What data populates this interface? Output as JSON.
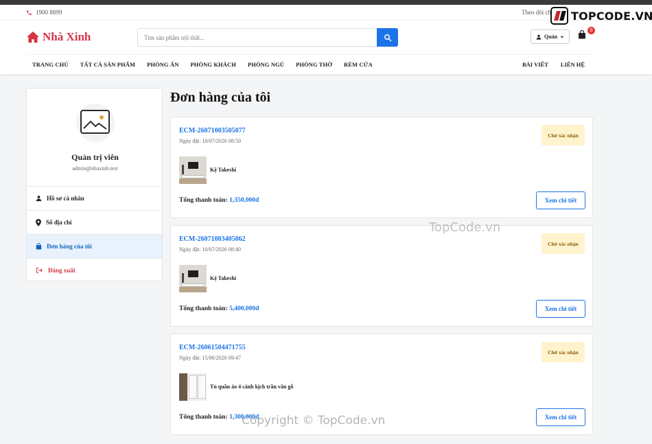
{
  "topbar": {
    "phone": "1900 8899",
    "follow_text": "Theo dõi ch"
  },
  "watermark_logo": {
    "text": "TOPCODE.VN"
  },
  "header": {
    "brand": "Nhà Xinh",
    "search_placeholder": "Tìm sản phẩm nội thất...",
    "user_label": "Quản",
    "cart_count": "0",
    "colors": {
      "brand": "#d63447",
      "accent": "#1a73e8"
    }
  },
  "nav": {
    "items": [
      "TRANG CHỦ",
      "TẤT CẢ SẢN PHẨM",
      "PHÒNG ĂN",
      "PHÒNG KHÁCH",
      "PHÒNG NGỦ",
      "PHÒNG THỜ",
      "RÈM CỬA"
    ],
    "right_items": [
      "BÀI VIẾT",
      "LIÊN HỆ"
    ]
  },
  "sidebar": {
    "avatar_icon": "image-icon",
    "name": "Quản trị viên",
    "email": "admin@nhaxinh.test",
    "menu": [
      {
        "label": "Hồ sơ cá nhân",
        "icon": "user-icon",
        "active": false
      },
      {
        "label": "Sổ địa chỉ",
        "icon": "map-pin-icon",
        "active": false
      },
      {
        "label": "Đơn hàng của tôi",
        "icon": "shopping-bag-icon",
        "active": true
      },
      {
        "label": "Đăng xuất",
        "icon": "sign-out-icon",
        "active": false
      }
    ]
  },
  "main": {
    "title": "Đơn hàng của tôi",
    "total_label": "Tổng thanh toán:",
    "detail_label": "Xem chi tiết",
    "orders": [
      {
        "code": "ECM-26071003505077",
        "date": "Ngày đặt: 10/07/2026 08:50",
        "status": "Chờ xác nhận",
        "product": "Kệ Takeshi",
        "thumb": "tv-stand-image",
        "total": "1,350,000đ"
      },
      {
        "code": "ECM-26071003405062",
        "date": "Ngày đặt: 10/07/2026 08:40",
        "status": "Chờ xác nhận",
        "product": "Kệ Takeshi",
        "thumb": "tv-stand-image",
        "total": "5,400,000đ"
      },
      {
        "code": "ECM-26061504471755",
        "date": "Ngày đặt: 15/06/2026 09:47",
        "status": "Chờ xác nhận",
        "product": "Tủ quần áo 4 cánh kịch trần vân gỗ",
        "thumb": "wardrobe-image",
        "total": "1,300,000đ"
      }
    ]
  },
  "watermarks": {
    "center": "TopCode.vn",
    "bottom": "Copyright © TopCode.vn"
  }
}
